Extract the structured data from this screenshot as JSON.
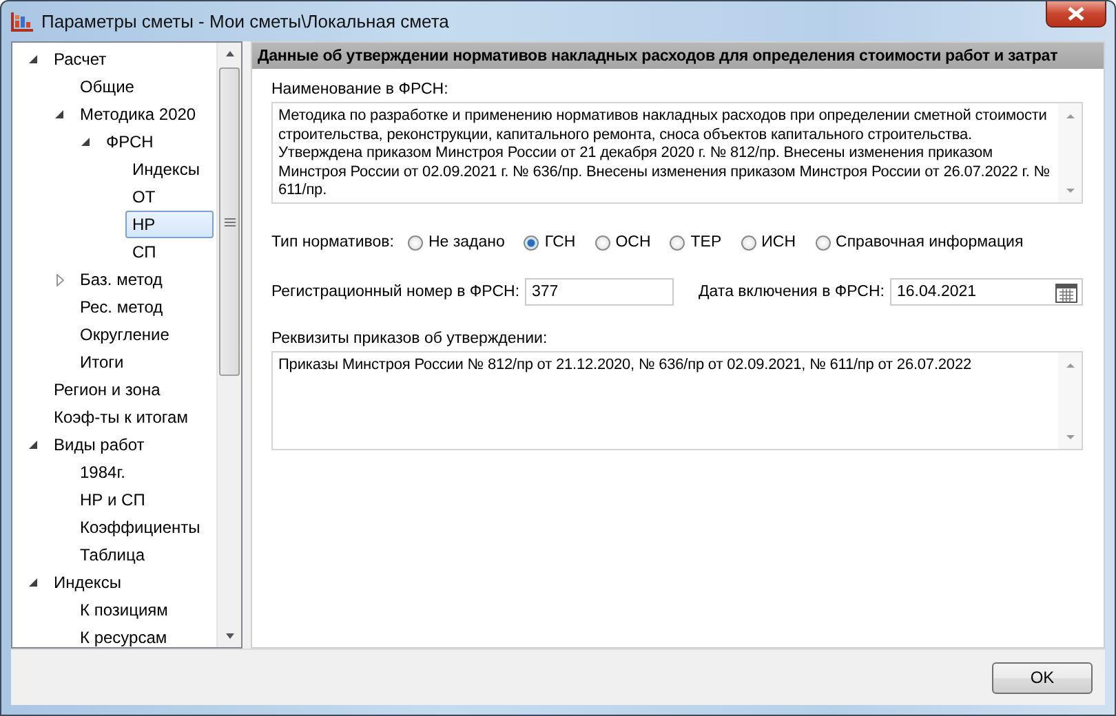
{
  "window": {
    "title": "Параметры сметы - Мои сметы\\Локальная смета"
  },
  "tree": [
    {
      "label": "Расчет",
      "expanded": true,
      "selected": false,
      "children": [
        {
          "label": "Общие",
          "selected": false
        },
        {
          "label": "Методика 2020",
          "expanded": true,
          "selected": false,
          "children": [
            {
              "label": "ФРСН",
              "expanded": true,
              "selected": false,
              "children": [
                {
                  "label": "Индексы",
                  "selected": false
                },
                {
                  "label": "ОТ",
                  "selected": false
                },
                {
                  "label": "НР",
                  "selected": true
                },
                {
                  "label": "СП",
                  "selected": false
                }
              ]
            }
          ]
        },
        {
          "label": "Баз. метод",
          "expanded": false,
          "selected": false
        },
        {
          "label": "Рес. метод",
          "selected": false
        },
        {
          "label": "Округление",
          "selected": false
        },
        {
          "label": "Итоги",
          "selected": false
        }
      ]
    },
    {
      "label": "Регион и зона",
      "selected": false
    },
    {
      "label": "Коэф-ты к итогам",
      "selected": false
    },
    {
      "label": "Виды работ",
      "expanded": true,
      "selected": false,
      "children": [
        {
          "label": "1984г.",
          "selected": false
        },
        {
          "label": "НР и СП",
          "selected": false
        },
        {
          "label": "Коэффициенты",
          "selected": false
        },
        {
          "label": "Таблица",
          "selected": false
        }
      ]
    },
    {
      "label": "Индексы",
      "expanded": true,
      "selected": false,
      "children": [
        {
          "label": "К позициям",
          "selected": false
        },
        {
          "label": "К ресурсам",
          "selected": false
        }
      ]
    }
  ],
  "panel": {
    "header": "Данные об утверждении нормативов накладных расходов для определения стоимости работ и затрат",
    "name_label": "Наименование в ФРСН:",
    "name_value": "Методика по разработке и применению нормативов накладных расходов при определении сметной стоимости строительства, реконструкции, капитального ремонта, сноса объектов капитального строительства. Утверждена приказом Минстроя России от 21 декабря 2020 г. № 812/пр. Внесены изменения приказом Минстроя России от 02.09.2021 г. № 636/пр. Внесены изменения приказом Минстроя России от 26.07.2022 г. № 611/пр.",
    "type_label": "Тип нормативов:",
    "type_options": [
      {
        "label": "Не задано",
        "selected": false
      },
      {
        "label": "ГСН",
        "selected": true
      },
      {
        "label": "ОСН",
        "selected": false
      },
      {
        "label": "ТЕР",
        "selected": false
      },
      {
        "label": "ИСН",
        "selected": false
      },
      {
        "label": "Справочная информация",
        "selected": false
      }
    ],
    "reg_label": "Регистрационный номер в ФРСН:",
    "reg_value": "377",
    "date_label": "Дата включения в ФРСН:",
    "date_value": "16.04.2021",
    "orders_label": "Реквизиты приказов об утверждении:",
    "orders_value": "Приказы Минстроя России № 812/пр от 21.12.2020, № 636/пр от 02.09.2021, № 611/пр от 26.07.2022"
  },
  "buttons": [
    {
      "label": "OK"
    }
  ]
}
